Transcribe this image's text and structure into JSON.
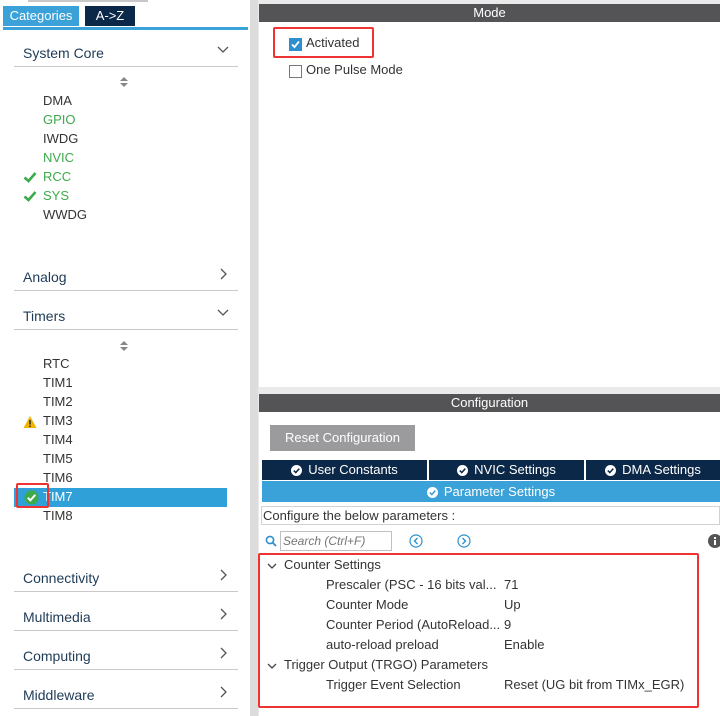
{
  "sidebar": {
    "tabs": {
      "categories": "Categories",
      "az": "A->Z"
    },
    "sections": {
      "system_core": "System Core",
      "analog": "Analog",
      "timers": "Timers",
      "connectivity": "Connectivity",
      "multimedia": "Multimedia",
      "computing": "Computing",
      "middleware": "Middleware"
    },
    "system_core_items": [
      "DMA",
      "GPIO",
      "IWDG",
      "NVIC",
      "RCC",
      "SYS",
      "WWDG"
    ],
    "timer_items": [
      "RTC",
      "TIM1",
      "TIM2",
      "TIM3",
      "TIM4",
      "TIM5",
      "TIM6",
      "TIM7",
      "TIM8"
    ]
  },
  "mode": {
    "title": "Mode",
    "activated_label": "Activated",
    "activated_checked": true,
    "one_pulse_label": "One Pulse Mode",
    "one_pulse_checked": false
  },
  "configuration": {
    "title": "Configuration",
    "reset_button": "Reset Configuration",
    "tabs": {
      "user_constants": "User Constants",
      "nvic_settings": "NVIC Settings",
      "dma_settings": "DMA Settings",
      "parameter_settings": "Parameter Settings"
    },
    "description": "Configure the below parameters :",
    "search_placeholder": "Search (Ctrl+F)",
    "groups": {
      "counter_settings": "Counter Settings",
      "trigger_output": "Trigger Output (TRGO) Parameters"
    },
    "params": {
      "prescaler": {
        "name": "Prescaler (PSC - 16 bits val...",
        "value": "71"
      },
      "counter_mode": {
        "name": "Counter Mode",
        "value": "Up"
      },
      "counter_period": {
        "name": "Counter Period (AutoReload...",
        "value": "9"
      },
      "auto_reload": {
        "name": "auto-reload preload",
        "value": "Enable"
      },
      "trigger_event": {
        "name": "Trigger Event Selection",
        "value": "Reset (UG bit from TIMx_EGR)"
      }
    }
  },
  "colors": {
    "accent": "#3aa2d8",
    "dark_tab": "#0b2849",
    "ok_green": "#3daa4c",
    "warning": "#f0b400",
    "highlight_red": "#e33333"
  }
}
